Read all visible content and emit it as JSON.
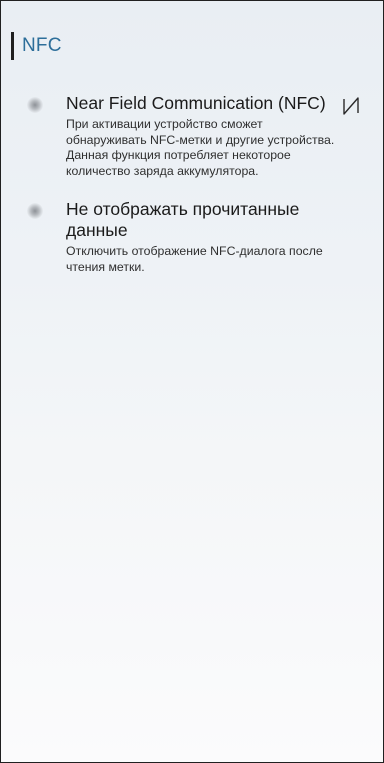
{
  "header": {
    "title": "NFC"
  },
  "settings": [
    {
      "title": "Near Field Communication (NFC)",
      "description": "При активации устройство сможет обнаруживать NFC-метки и другие устройства. Данная функция потребляет некоторое количество заряда аккумулятора.",
      "icon": "nfc-icon"
    },
    {
      "title": "Не отображать прочитанные данные",
      "description": "Отключить отображение NFC-диалога после чтения метки."
    }
  ],
  "colors": {
    "title_accent": "#2d6e9a",
    "text_primary": "#1b1b1b"
  }
}
